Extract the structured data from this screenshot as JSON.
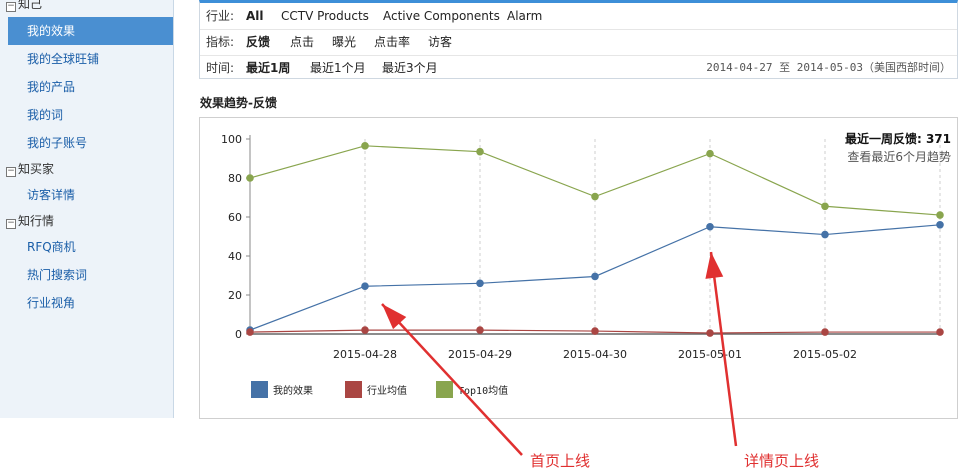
{
  "sidebar": {
    "group_zhiji": "知己",
    "items_zhiji": [
      "我的效果",
      "我的全球旺铺",
      "我的产品",
      "我的词",
      "我的子账号"
    ],
    "group_zhimaijia": "知买家",
    "items_zhimaijia": [
      "访客详情"
    ],
    "group_zhihangqing": "知行情",
    "items_zhihangqing": [
      "RFQ商机",
      "热门搜索词",
      "行业视角"
    ],
    "toggle_glyph": "−"
  },
  "filters": {
    "industry_label": "行业:",
    "industry_options": [
      "All",
      "CCTV Products",
      "Active Components",
      "Alarm"
    ],
    "metric_label": "指标:",
    "metric_options": [
      "反馈",
      "点击",
      "曝光",
      "点击率",
      "访客"
    ],
    "time_label": "时间:",
    "time_options": [
      "最近1周",
      "最近1个月",
      "最近3个月"
    ],
    "date_range": "2014-04-27 至 2014-05-03（美国西部时间）"
  },
  "section_title": "效果趋势-反馈",
  "summary": {
    "main": "最近一周反馈: 371",
    "link": "查看最近6个月趋势"
  },
  "chart_data": {
    "type": "line",
    "x": [
      "",
      "2015-04-28",
      "2015-04-29",
      "2015-04-30",
      "2015-05-01",
      "2015-05-02",
      ""
    ],
    "ylim": [
      0,
      100
    ],
    "yticks": [
      0,
      20,
      40,
      60,
      80,
      100
    ],
    "grid": "dashed vertical lines at each date",
    "legend_position": "bottom-left",
    "series": [
      {
        "name": "我的效果",
        "color": "#4572a7",
        "values": [
          2,
          24.5,
          26,
          29.5,
          55,
          51,
          56
        ]
      },
      {
        "name": "行业均值",
        "color": "#aa4643",
        "values": [
          1,
          2,
          2,
          1.5,
          0.5,
          1,
          1
        ]
      },
      {
        "name": "Top10均值",
        "color": "#89a54e",
        "values": [
          80,
          96.5,
          93.5,
          70.5,
          92.5,
          65.5,
          61
        ]
      }
    ]
  },
  "annotations": {
    "homepage": "首页上线",
    "detailpage": "详情页上线",
    "color": "#e03030"
  }
}
